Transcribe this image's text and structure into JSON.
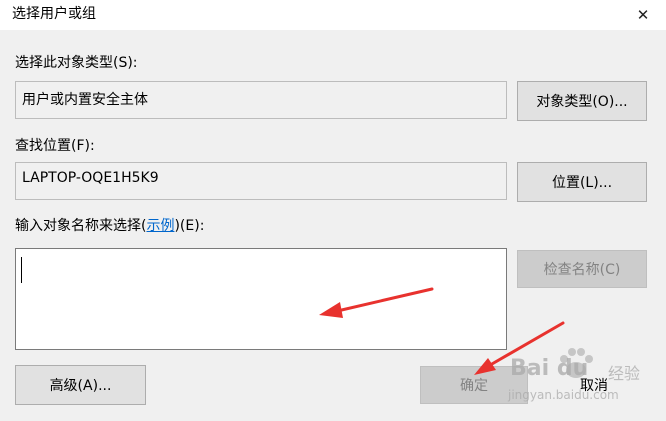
{
  "window": {
    "title": "选择用户或组",
    "close_symbol": "✕"
  },
  "object_type": {
    "label": "选择此对象类型(S):",
    "value": "用户或内置安全主体",
    "button": "对象类型(O)..."
  },
  "location": {
    "label": "查找位置(F):",
    "value": "LAPTOP-OQE1H5K9",
    "button": "位置(L)..."
  },
  "names": {
    "label_prefix": "输入对象名称来选择(",
    "label_link": "示例",
    "label_suffix": ")(E):",
    "value": "",
    "check_button": "检查名称(C)"
  },
  "footer": {
    "advanced_button": "高级(A)...",
    "ok_button": "确定",
    "cancel_button": "取消"
  },
  "watermark": {
    "brand": "Bai du",
    "sub": "经验",
    "url": "jingyan.baidu.com"
  },
  "colors": {
    "annotation_arrow": "#e8322e",
    "link": "#0066cc"
  }
}
